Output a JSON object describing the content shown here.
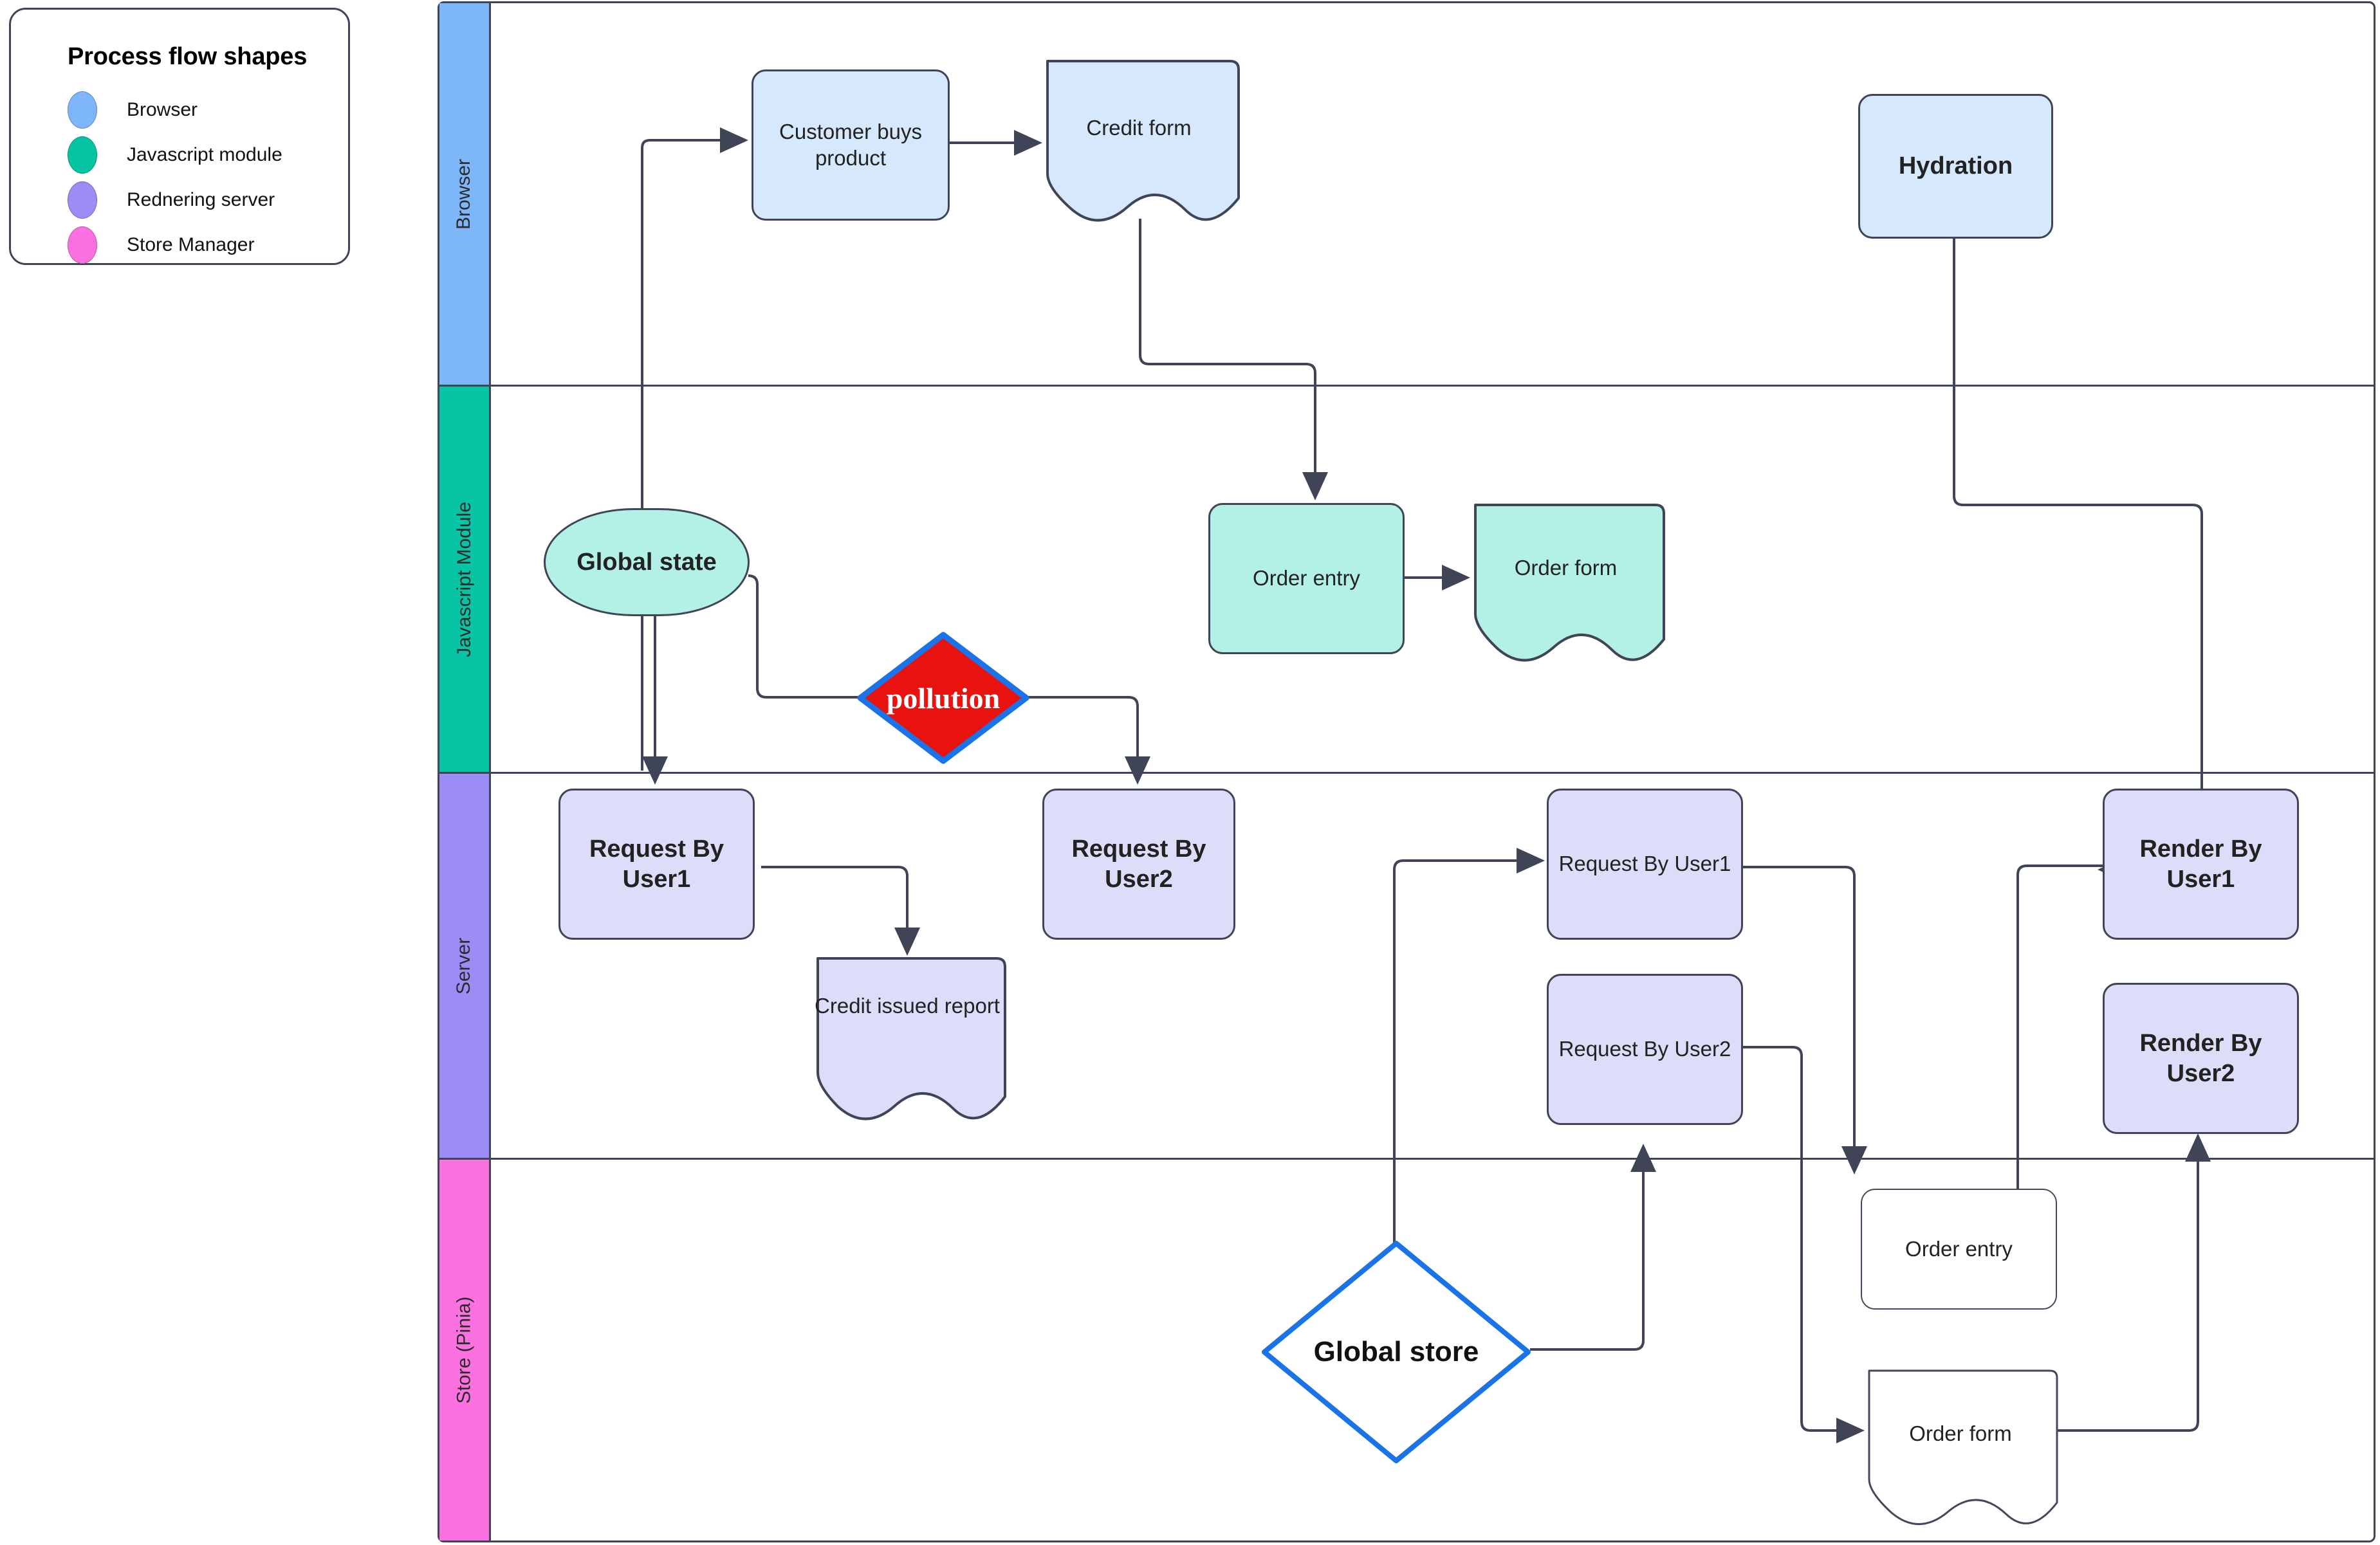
{
  "legend": {
    "title": "Process flow shapes",
    "items": [
      {
        "label": "Browser",
        "color": "#7eb6fa"
      },
      {
        "label": "Javascript module",
        "color": "#06c4a4"
      },
      {
        "label": "Rednering server",
        "color": "#9c8cf5"
      },
      {
        "label": "Store Manager",
        "color": "#fc71e0"
      }
    ]
  },
  "lanes": [
    {
      "label": "Browser",
      "color": "#7eb6fa"
    },
    {
      "label": "Javascript Module",
      "color": "#06c4a4"
    },
    {
      "label": "Server",
      "color": "#9c8cf5"
    },
    {
      "label": "Store (Pinia)",
      "color": "#fc71e0"
    }
  ],
  "nodes": {
    "customer_buys_product": "Customer buys product",
    "credit_form": "Credit form",
    "hydration": "Hydration",
    "global_state": "Global state",
    "pollution": "pollution",
    "order_entry_js": "Order entry",
    "order_form_js": "Order form",
    "request_by_user1_left": "Request By User1",
    "credit_issued_report": "Credit issued report",
    "request_by_user2_left": "Request By User2",
    "request_by_user1_right": "Request By User1",
    "request_by_user2_right": "Request By User2",
    "render_by_user1": "Render By User1",
    "render_by_user2": "Render By User2",
    "global_store": "Global store",
    "order_entry_store": "Order entry",
    "order_form_store": "Order form"
  },
  "colors": {
    "browser_fill": "#d5e8fc",
    "js_fill": "#b3f0e6",
    "server_fill": "#ddddfa",
    "store_fill": "#ffffff",
    "stroke": "#3f4456",
    "pollution_fill": "#e8120f",
    "pollution_stroke": "#1a73e8",
    "global_store_stroke": "#1a73e8"
  }
}
